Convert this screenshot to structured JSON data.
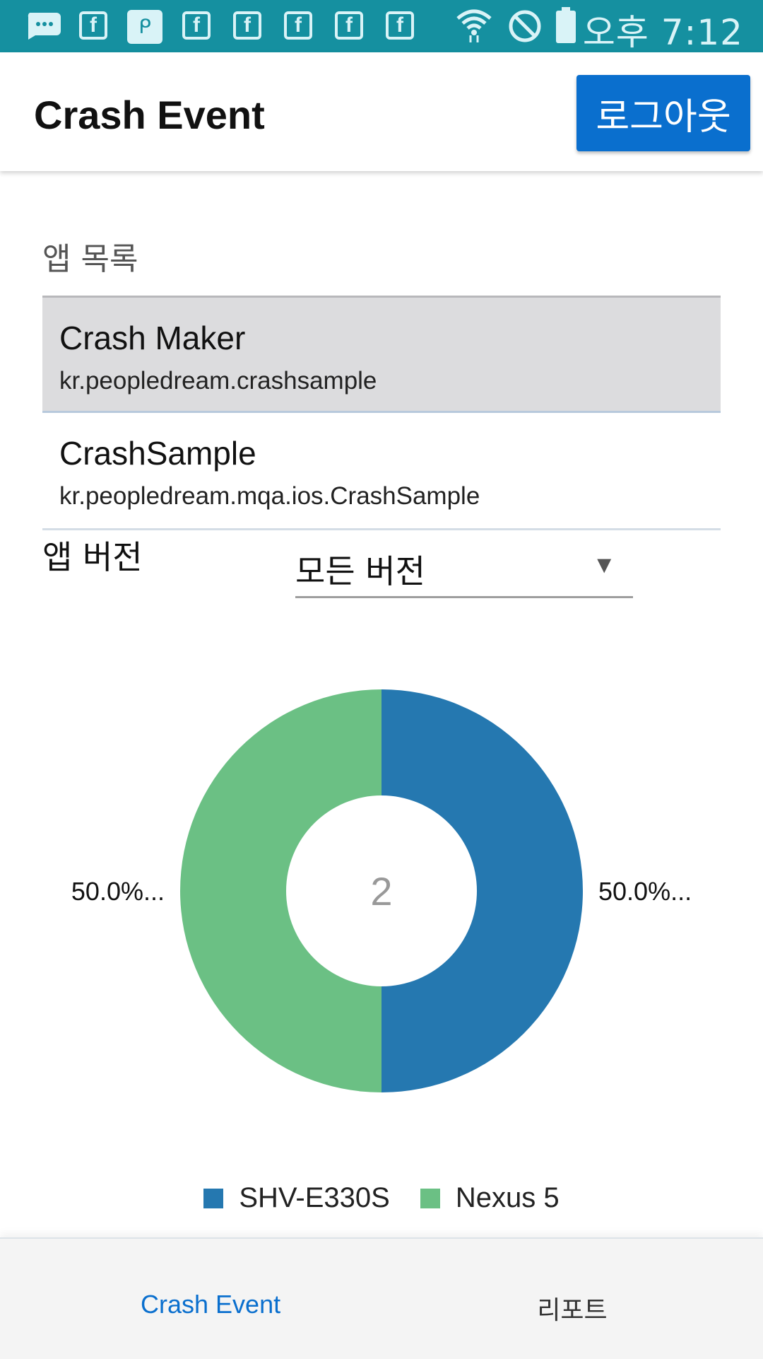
{
  "status_bar": {
    "time": "오후 7:12",
    "notification_icons": [
      "message-icon",
      "f-app-icon",
      "p-app-icon",
      "f-app-icon",
      "f-app-icon",
      "f-app-icon",
      "f-app-icon",
      "f-app-icon"
    ],
    "system_icons": [
      "wifi-icon",
      "do-not-disturb-icon",
      "battery-icon"
    ]
  },
  "header": {
    "title": "Crash Event",
    "logout_label": "로그아웃"
  },
  "app_list": {
    "label": "앱 목록",
    "items": [
      {
        "name": "Crash Maker",
        "package": "kr.peopledream.crashsample",
        "selected": true
      },
      {
        "name": "CrashSample",
        "package": "kr.peopledream.mqa.ios.CrashSample",
        "selected": false
      }
    ]
  },
  "version": {
    "label": "앱 버전",
    "selected": "모든 버전",
    "arrow": "▼"
  },
  "chart_data": {
    "type": "pie",
    "center_label": "2",
    "slices": [
      {
        "name": "SHV-E330S",
        "value": 50.0,
        "label": "50.0%...",
        "color": "#2578b0"
      },
      {
        "name": "Nexus 5",
        "value": 50.0,
        "label": "50.0%...",
        "color": "#6bc084"
      }
    ],
    "legend_position": "bottom"
  },
  "bottom_nav": {
    "tabs": [
      {
        "label": "Crash Event",
        "active": true
      },
      {
        "label": "리포트",
        "active": false
      }
    ]
  },
  "colors": {
    "status_bar": "#1590a0",
    "accent": "#0a6fce",
    "selected_row": "#dcdcde"
  }
}
